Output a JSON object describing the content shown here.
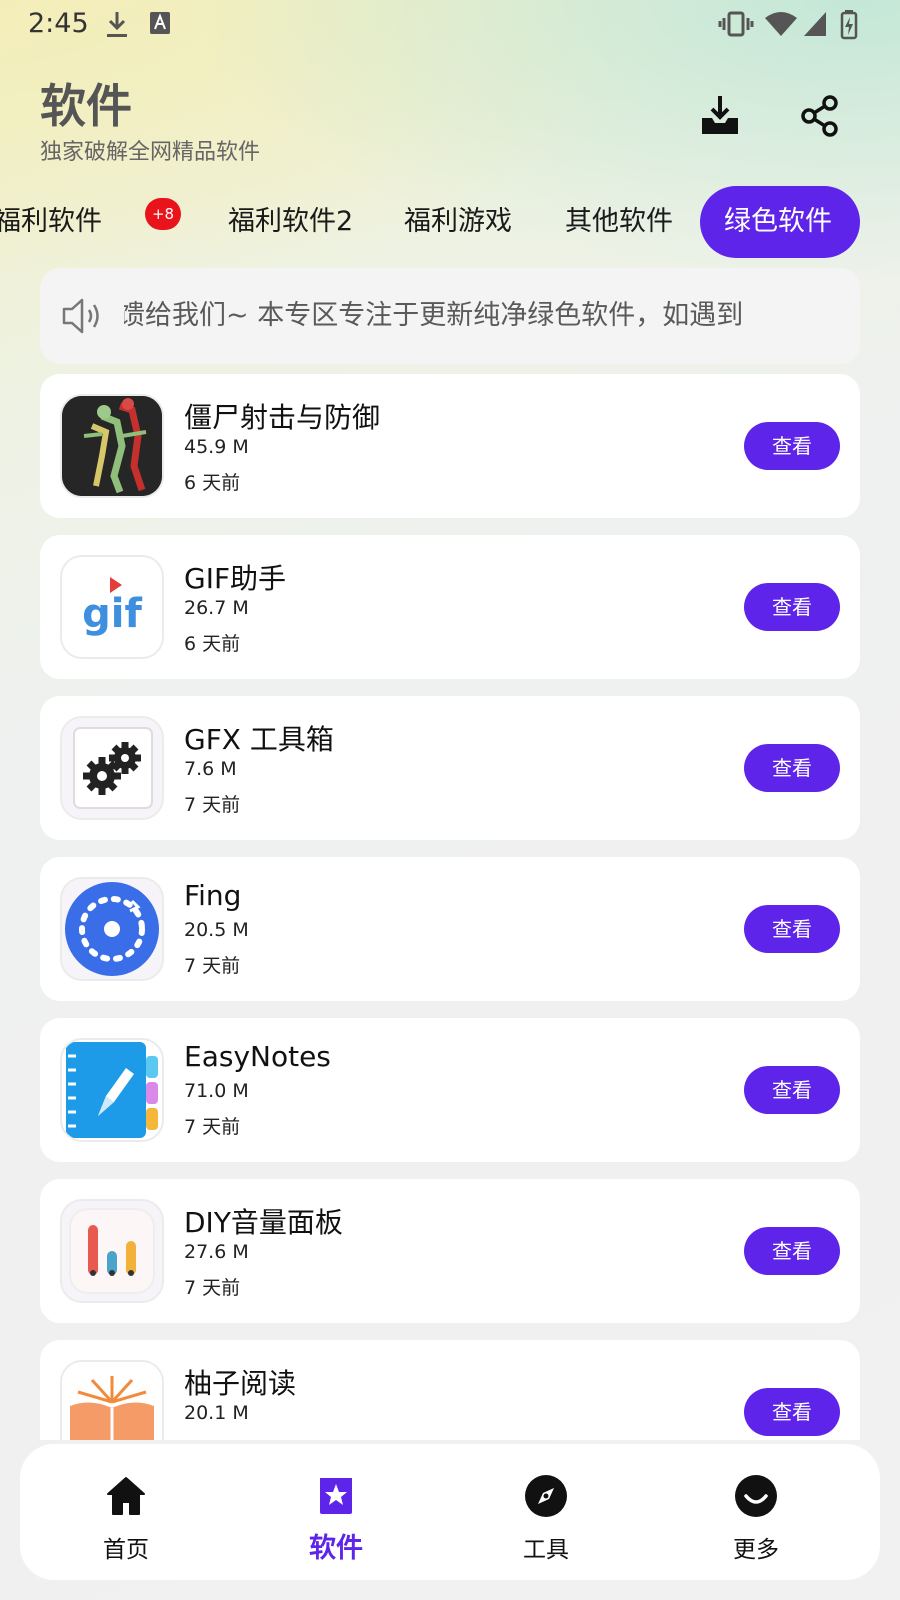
{
  "status_bar": {
    "time": "2:45"
  },
  "header": {
    "title": "软件",
    "subtitle": "独家破解全网精品软件"
  },
  "tabs": [
    {
      "label": "福利软件",
      "badge": "+8"
    },
    {
      "label": "福利软件2"
    },
    {
      "label": "福利游戏"
    },
    {
      "label": "其他软件"
    },
    {
      "label": "绿色软件",
      "active": true
    }
  ],
  "notice": {
    "text": "馈给我们~   本专区专注于更新纯净绿色软件，如遇到"
  },
  "apps": [
    {
      "name": "僵尸射击与防御",
      "size": "45.9 M",
      "date": "6 天前",
      "button": "查看",
      "icon": "zombie-game-icon"
    },
    {
      "name": "GIF助手",
      "size": "26.7 M",
      "date": "6 天前",
      "button": "查看",
      "icon": "gif-icon"
    },
    {
      "name": "GFX 工具箱",
      "size": "7.6 M",
      "date": "7 天前",
      "button": "查看",
      "icon": "gears-icon"
    },
    {
      "name": "Fing",
      "size": "20.5 M",
      "date": "7 天前",
      "button": "查看",
      "icon": "fing-icon"
    },
    {
      "name": "EasyNotes",
      "size": "71.0 M",
      "date": "7 天前",
      "button": "查看",
      "icon": "notebook-icon"
    },
    {
      "name": "DIY音量面板",
      "size": "27.6 M",
      "date": "7 天前",
      "button": "查看",
      "icon": "volume-panel-icon"
    },
    {
      "name": "柚子阅读",
      "size": "20.1 M",
      "date": "",
      "button": "查看",
      "icon": "book-icon"
    }
  ],
  "bottom_nav": [
    {
      "label": "首页",
      "icon": "home-icon"
    },
    {
      "label": "软件",
      "icon": "star-badge-icon",
      "active": true
    },
    {
      "label": "工具",
      "icon": "compass-icon"
    },
    {
      "label": "更多",
      "icon": "smile-icon"
    }
  ],
  "colors": {
    "accent": "#5e24ea",
    "badge": "#e8131b",
    "card": "#ffffff"
  }
}
